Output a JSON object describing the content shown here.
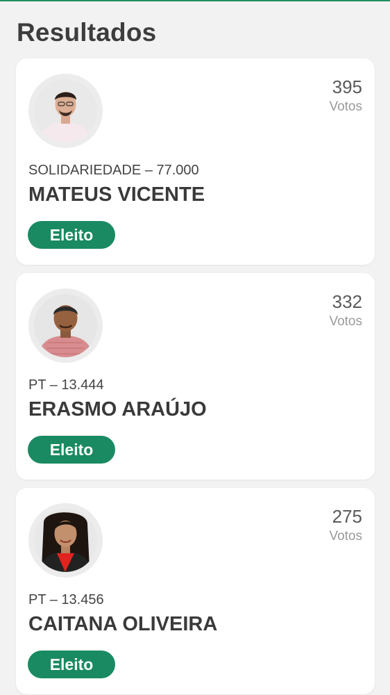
{
  "page": {
    "title": "Resultados"
  },
  "colors": {
    "accent": "#198a61",
    "background": "#f2f2f2",
    "card": "#ffffff"
  },
  "candidates": [
    {
      "votes": "395",
      "votes_label": "Votos",
      "party": "SOLIDARIEDADE – 77.000",
      "name": "MATEUS VICENTE",
      "status": "Eleito",
      "avatar": "candidate-photo"
    },
    {
      "votes": "332",
      "votes_label": "Votos",
      "party": "PT – 13.444",
      "name": "ERASMO ARAÚJO",
      "status": "Eleito",
      "avatar": "candidate-photo"
    },
    {
      "votes": "275",
      "votes_label": "Votos",
      "party": "PT – 13.456",
      "name": "CAITANA OLIVEIRA",
      "status": "Eleito",
      "avatar": "candidate-photo"
    }
  ]
}
